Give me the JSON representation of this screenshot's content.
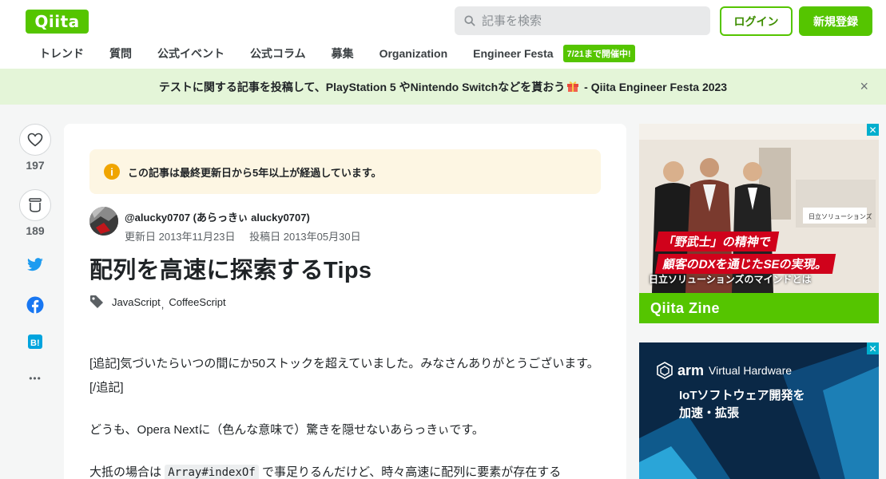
{
  "header": {
    "logo": "Qiita",
    "search_placeholder": "記事を検索",
    "login_label": "ログイン",
    "signup_label": "新規登録",
    "nav": [
      "トレンド",
      "質問",
      "公式イベント",
      "公式コラム",
      "募集",
      "Organization",
      "Engineer Festa"
    ],
    "festa_badge": "7/21まで開催中!"
  },
  "banner": {
    "text_before": "テストに関する記事を投稿して、PlayStation 5 やNintendo Switchなどを貰おう",
    "text_after": " - Qiita Engineer Festa 2023",
    "close": "×"
  },
  "rail": {
    "likes": "197",
    "stocks": "189",
    "more": "•••"
  },
  "article": {
    "notice": "この記事は最終更新日から5年以上が経過しています。",
    "author": "@alucky0707 (あらっきぃ alucky0707)",
    "updated": "更新日 2013年11月23日",
    "posted": "投稿日 2013年05月30日",
    "title": "配列を高速に探索するTips",
    "tags": [
      "JavaScript",
      "CoffeeScript"
    ],
    "p1": "[追記]気づいたらいつの間にか50ストックを超えていました。みなさんありがとうございます。[/追記]",
    "p2": "どうも、Opera Nextに（色んな意味で）驚きを隠せないあらっきぃです。",
    "p3_before": "大抵の場合は",
    "p3_code": "Array#indexOf",
    "p3_after": "で事足りるんだけど、時々高速に配列に要素が存在する"
  },
  "ads": {
    "ad1_line1": "「野武士」の精神で",
    "ad1_line2": "顧客のDXを通じたSEの実現。",
    "ad1_sub": "日立ソリューションズのマインドとは",
    "ad1_brand": "Qiita Zine",
    "ad1_sign": "日立ソリューションズ",
    "ad2_arm": "arm",
    "ad2_vh": "Virtual Hardware",
    "ad2_title1": "IoTソフトウェア開発を",
    "ad2_title2": "加速・拡張",
    "close": "✕"
  }
}
